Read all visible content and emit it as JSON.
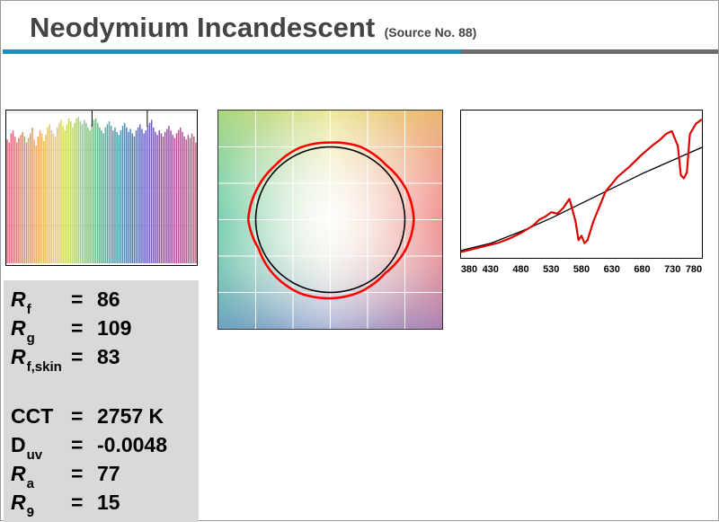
{
  "header": {
    "title": "Neodymium Incandescent",
    "subtitle": "(Source No. 88)",
    "accent_blue": "#1a8fc1",
    "accent_gray": "#6d6d6d"
  },
  "metrics": [
    {
      "symbol": "R",
      "subscript": "f",
      "italic": true,
      "equals": "=",
      "value": "86"
    },
    {
      "symbol": "R",
      "subscript": "g",
      "italic": true,
      "equals": "=",
      "value": "109"
    },
    {
      "symbol": "R",
      "subscript": "f,skin",
      "italic": true,
      "equals": "=",
      "value": "83"
    },
    {
      "symbol": "CCT",
      "subscript": "",
      "italic": false,
      "equals": "=",
      "value": "2757 K"
    },
    {
      "symbol": "D",
      "subscript": "uv",
      "italic": false,
      "equals": "=",
      "value": "-0.0048"
    },
    {
      "symbol": "R",
      "subscript": "a",
      "italic": true,
      "equals": "=",
      "value": "77"
    },
    {
      "symbol": "R",
      "subscript": "9",
      "italic": true,
      "equals": "=",
      "value": "15"
    }
  ],
  "chart_data": [
    {
      "type": "bar",
      "chart": "color-sample-fidelity",
      "count": 99,
      "ylim": [
        0,
        100
      ],
      "values": [
        82,
        80,
        86,
        88,
        84,
        80,
        83,
        85,
        87,
        84,
        80,
        83,
        86,
        90,
        82,
        78,
        84,
        88,
        86,
        81,
        85,
        90,
        92,
        88,
        86,
        84,
        90,
        93,
        95,
        91,
        88,
        92,
        96,
        94,
        90,
        93,
        96,
        97,
        94,
        92,
        95,
        93,
        90,
        88,
        92,
        95,
        96,
        93,
        90,
        88,
        86,
        90,
        92,
        94,
        91,
        88,
        90,
        87,
        85,
        88,
        91,
        93,
        90,
        87,
        89,
        86,
        84,
        88,
        90,
        92,
        89,
        86,
        88,
        91,
        93,
        95,
        90,
        87,
        85,
        88,
        86,
        84,
        87,
        89,
        91,
        88,
        85,
        83,
        86,
        88,
        90,
        87,
        84,
        82,
        85,
        83,
        86,
        84,
        80
      ],
      "gridlines": [
        25,
        50,
        75,
        100
      ],
      "colors": [
        "#e06a7a",
        "#e07a74",
        "#e38a6c",
        "#e69a64",
        "#e8aa5e",
        "#eab85a",
        "#e9c458",
        "#e3ce58",
        "#d6d65c",
        "#c3d862",
        "#aed46a",
        "#98cd72",
        "#82c47c",
        "#6fba88",
        "#5fb094",
        "#54a6a0",
        "#4e9aab",
        "#4c8db5",
        "#4f80bd",
        "#5774c2",
        "#6268c4",
        "#705fc2",
        "#7f58bd",
        "#8e53b6",
        "#9c51ad",
        "#a951a3",
        "#b45398",
        "#bd588d",
        "#c45f83"
      ]
    },
    {
      "type": "line",
      "chart": "color-vector-graphic",
      "xlim": [
        -1.5,
        1.5
      ],
      "ylim": [
        -1.5,
        1.5
      ],
      "series": [
        {
          "role": "reference",
          "color": "#000000",
          "radius": [
            1,
            1,
            1,
            1,
            1,
            1,
            1,
            1,
            1,
            1,
            1,
            1,
            1,
            1,
            1,
            1
          ]
        },
        {
          "role": "test",
          "color": "#ff0000",
          "radius": [
            1.08,
            1.07,
            1.04,
            1.09,
            1.12,
            1.1,
            1.06,
            1.08,
            1.06,
            1.07,
            1.05,
            1.07,
            1.1,
            1.04,
            1.07,
            1.09
          ]
        }
      ]
    },
    {
      "type": "line",
      "chart": "spectral-power-distribution",
      "xlim": [
        380,
        780
      ],
      "ylim": [
        0,
        1
      ],
      "tick_labels": [
        "380",
        "430",
        "480",
        "530",
        "580",
        "630",
        "680",
        "730",
        "780"
      ],
      "series": [
        {
          "role": "reference",
          "color": "#000000",
          "x": [
            380,
            430,
            480,
            530,
            580,
            630,
            680,
            730,
            780
          ],
          "y": [
            0.05,
            0.1,
            0.18,
            0.27,
            0.37,
            0.47,
            0.57,
            0.66,
            0.75
          ]
        },
        {
          "role": "test",
          "color": "#dd0000",
          "x": [
            380,
            400,
            420,
            440,
            460,
            480,
            500,
            510,
            520,
            530,
            540,
            550,
            560,
            570,
            575,
            580,
            585,
            590,
            600,
            620,
            640,
            660,
            680,
            700,
            710,
            720,
            730,
            740,
            745,
            750,
            755,
            760,
            770,
            780
          ],
          "y": [
            0.04,
            0.06,
            0.08,
            0.1,
            0.13,
            0.17,
            0.22,
            0.26,
            0.28,
            0.31,
            0.3,
            0.34,
            0.4,
            0.25,
            0.12,
            0.15,
            0.1,
            0.12,
            0.25,
            0.45,
            0.55,
            0.62,
            0.7,
            0.77,
            0.8,
            0.84,
            0.86,
            0.76,
            0.56,
            0.54,
            0.58,
            0.84,
            0.91,
            0.94
          ]
        }
      ]
    }
  ]
}
